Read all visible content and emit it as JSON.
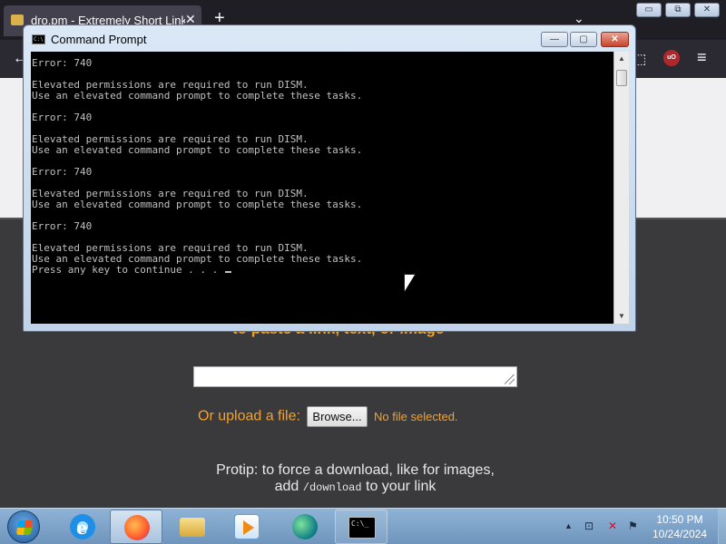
{
  "browser": {
    "tab_title": "dro.pm - Extremely Short Links",
    "tab_close": "✕",
    "new_tab": "+",
    "tab_list": "⌄",
    "nav_back": "←",
    "ublock_label": "uO",
    "menu": "≡",
    "extensions": "⬚"
  },
  "page": {
    "heading_partial": "to paste a link, text, or image",
    "upload_label": "Or upload a file:",
    "browse_label": "Browse...",
    "no_file": "No file selected.",
    "protip_line1": "Protip: to force a download, like for images,",
    "protip_add": "add",
    "protip_code": "/download",
    "protip_suffix": "to your link"
  },
  "window_controls": {
    "minimize": "▭",
    "maximize": "⧉",
    "close": "✕"
  },
  "cmd": {
    "title": "Command Prompt",
    "icon_text": "C:\\",
    "btn_min": "—",
    "btn_max": "▢",
    "btn_close": "✕",
    "lines": [
      "Error: 740",
      "",
      "Elevated permissions are required to run DISM.",
      "Use an elevated command prompt to complete these tasks.",
      "",
      "Error: 740",
      "",
      "Elevated permissions are required to run DISM.",
      "Use an elevated command prompt to complete these tasks.",
      "",
      "Error: 740",
      "",
      "Elevated permissions are required to run DISM.",
      "Use an elevated command prompt to complete these tasks.",
      "",
      "Error: 740",
      "",
      "Elevated permissions are required to run DISM.",
      "Use an elevated command prompt to complete these tasks.",
      "Press any key to continue . . . "
    ],
    "scroll_up": "▲",
    "scroll_down": "▼"
  },
  "taskbar": {
    "cmd_icon_text": "C:\\_",
    "tray_arrow": "▲",
    "tray_network": "⊡",
    "tray_volume": "✕",
    "tray_flag": "⚑",
    "time": "10:50 PM",
    "date": "10/24/2024"
  },
  "icons": [
    "back-arrow-icon",
    "firefox-icon",
    "ie-icon",
    "folder-icon",
    "media-player-icon",
    "edge-icon",
    "command-prompt-icon",
    "windows-start-icon",
    "ublock-icon",
    "hamburger-menu-icon"
  ]
}
